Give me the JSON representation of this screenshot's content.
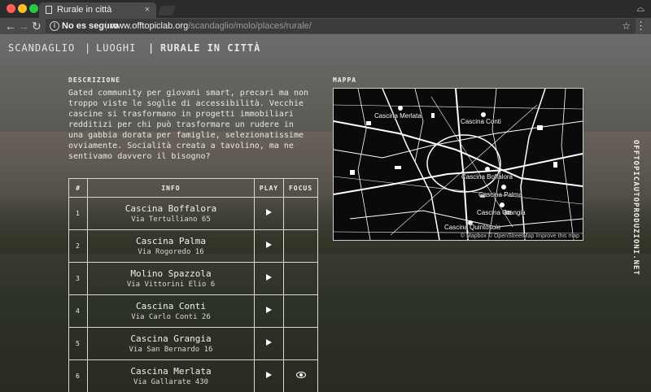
{
  "browser": {
    "tab_title": "Rurale in città",
    "tab_close": "×",
    "incognito_icon": "⌓",
    "security_text": "No es seguro",
    "url_host": "www.offtopiclab.org",
    "url_path": "/scandaglio/molo/places/rurale/",
    "nav_back": "←",
    "nav_forward": "→",
    "nav_reload": "↻",
    "info_icon": "i",
    "star_icon": "☆",
    "menu_icon": "⋮",
    "colors": {
      "close": "#ff5f57",
      "minimize": "#febc2e",
      "maximize": "#28c840"
    }
  },
  "topnav": {
    "item1": "SCANDAGLIO",
    "sep1": "|",
    "item2": "LUOGHI",
    "sep2": "|",
    "item3": "RURALE IN CITTÀ"
  },
  "description": {
    "label": "DESCRIZIONE",
    "text": "Gated community per giovani smart, precari ma non troppo viste le soglie di accessibilità. Vecchie cascine si trasformano in progetti immobiliari redditizi per chi può trasformare un rudere in una gabbia dorata per famiglie, selezionatissime ovviamente. Socialità creata a tavolino, ma ne sentivamo davvero il bisogno?"
  },
  "table": {
    "headers": {
      "num": "#",
      "info": "INFO",
      "play": "PLAY",
      "focus": "FOCUS"
    },
    "rows": [
      {
        "num": "1",
        "name": "Cascina Boffalora",
        "addr": "Via Tertulliano 65"
      },
      {
        "num": "2",
        "name": "Cascina Palma",
        "addr": "Via Rogoredo 16"
      },
      {
        "num": "3",
        "name": "Molino Spazzola",
        "addr": "Via Vittorini Elio 6"
      },
      {
        "num": "4",
        "name": "Cascina Conti",
        "addr": "Via Carlo Conti 26"
      },
      {
        "num": "5",
        "name": "Cascina Grangia",
        "addr": "Via San Bernardo 16"
      },
      {
        "num": "6",
        "name": "Cascina Merlata",
        "addr": "Via Gallarate 430"
      }
    ]
  },
  "map": {
    "label": "MAPPA",
    "markers": {
      "merlata": "Cascina Merlata",
      "conti": "Cascina Conti",
      "boffalora": "Cascina Boffalora",
      "palma": "Cascina Palma",
      "grangia": "Cascina Grangia",
      "quintosole": "Cascina Quintosole"
    },
    "attribution": "© Mapbox © OpenStreetMap Improve this map"
  },
  "sidebar": {
    "vertical_text": "OFFTOPICAUTOPRODUZIONI.NET"
  }
}
